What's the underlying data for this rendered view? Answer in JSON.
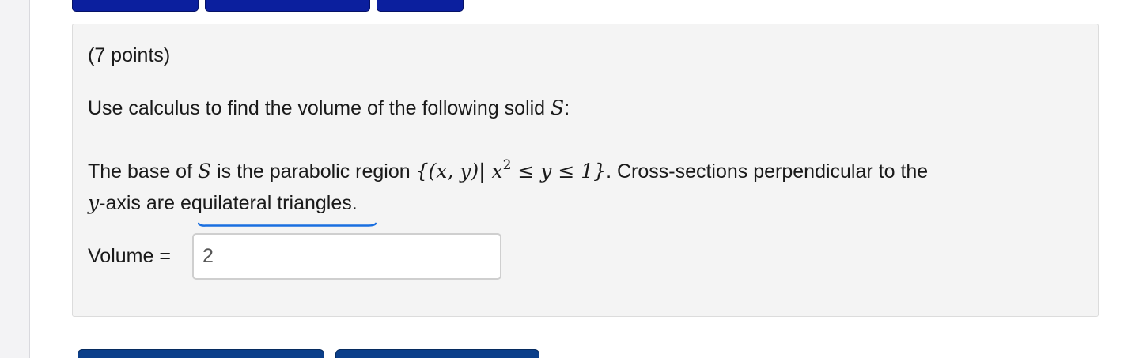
{
  "problem": {
    "points_label": "(7 points)",
    "prompt_text": "Use calculus to find the volume of the following solid ",
    "prompt_var": "S",
    "prompt_end": ":",
    "desc_part1": "The base of ",
    "desc_var_s": "S",
    "desc_part2": " is the parabolic region ",
    "set_open": "{(x, y)| x",
    "set_exp": "2",
    "set_close": " ≤ y ≤ 1}",
    "desc_part3": ". Cross-sections perpendicular to the ",
    "desc_var_y": "y",
    "desc_part4": "-axis are ",
    "desc_underlined": "equilateral triangles.",
    "volume_label": "Volume =",
    "volume_value": "2"
  },
  "colors": {
    "nav_button": "#0b1f9e",
    "submit_button": "#0b3f8a",
    "spellcheck_underline": "#1a6fe0",
    "panel_background": "#f4f4f4"
  }
}
